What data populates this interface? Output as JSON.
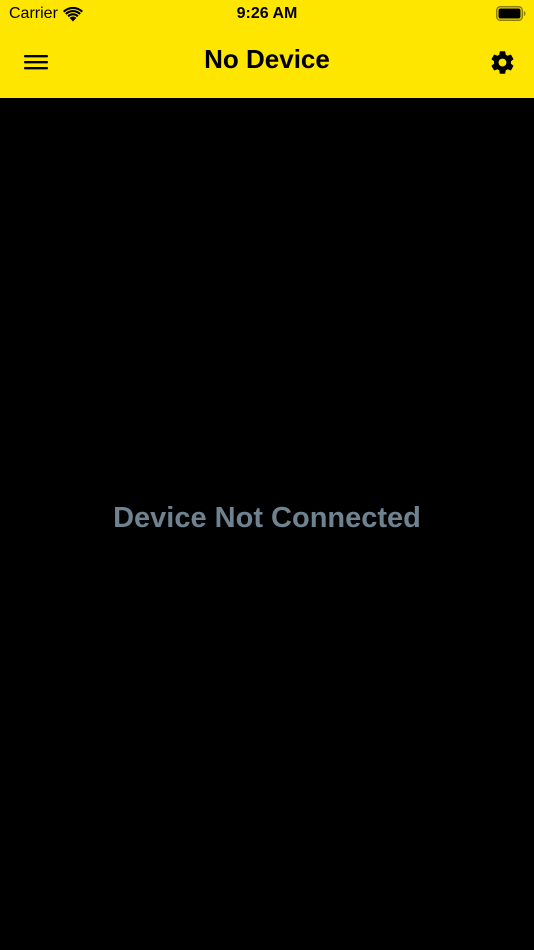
{
  "status_bar": {
    "carrier": "Carrier",
    "time": "9:26 AM"
  },
  "navbar": {
    "title": "No Device",
    "menu_icon": "hamburger-menu-icon",
    "settings_icon": "gear-icon"
  },
  "content": {
    "message": "Device Not Connected"
  },
  "colors": {
    "header_bg": "#FFE600",
    "content_bg": "#000000",
    "message_text": "#6E8290"
  }
}
